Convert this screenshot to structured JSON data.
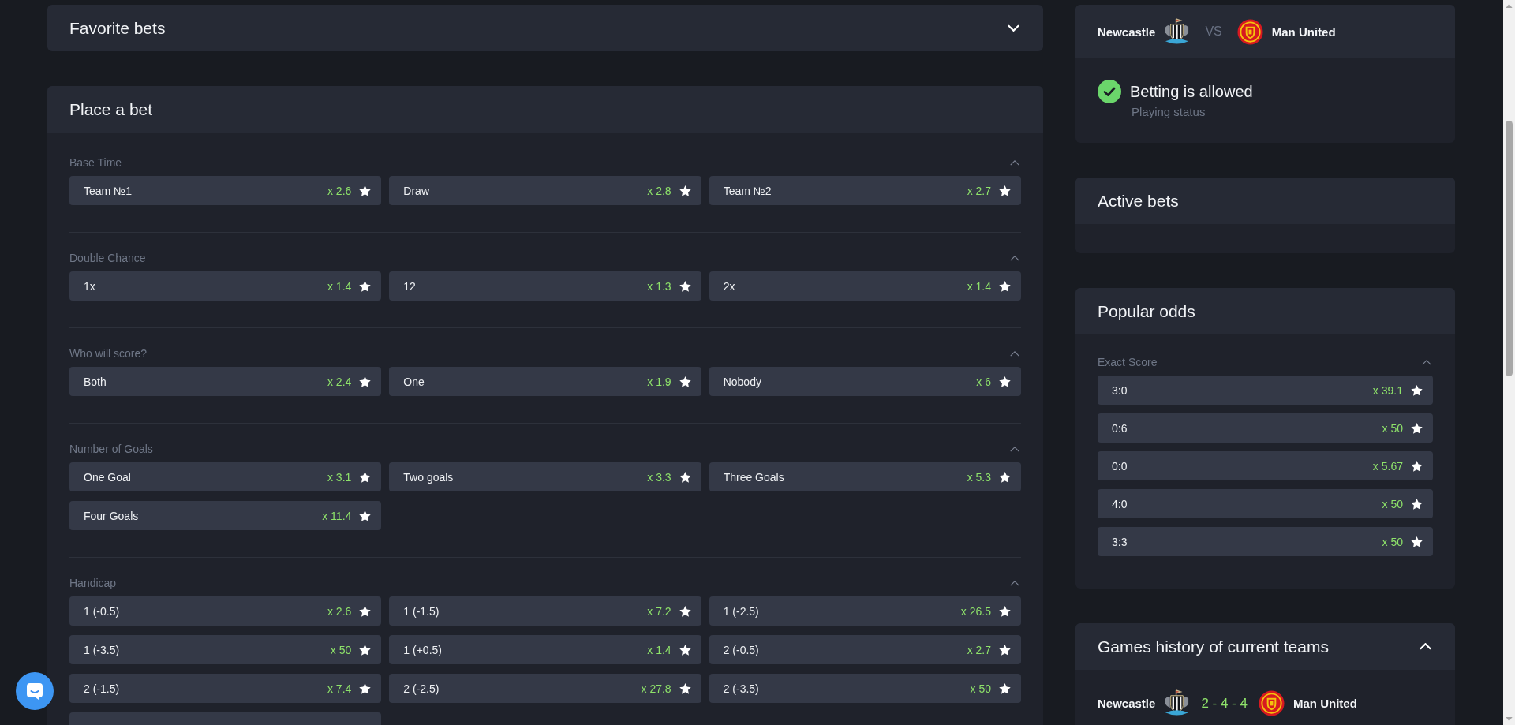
{
  "favorite_bets": {
    "title": "Favorite bets",
    "expanded": false
  },
  "place_a_bet": {
    "title": "Place a bet",
    "sections": [
      {
        "title": "Base Time",
        "expanded": true,
        "options": [
          {
            "label": "Team №1",
            "odds": "x 2.6"
          },
          {
            "label": "Draw",
            "odds": "x 2.8"
          },
          {
            "label": "Team №2",
            "odds": "x 2.7"
          }
        ]
      },
      {
        "title": "Double Chance",
        "expanded": true,
        "options": [
          {
            "label": "1x",
            "odds": "x 1.4"
          },
          {
            "label": "12",
            "odds": "x 1.3"
          },
          {
            "label": "2x",
            "odds": "x 1.4"
          }
        ]
      },
      {
        "title": "Who will score?",
        "expanded": true,
        "options": [
          {
            "label": "Both",
            "odds": "x 2.4"
          },
          {
            "label": "One",
            "odds": "x 1.9"
          },
          {
            "label": "Nobody",
            "odds": "x 6"
          }
        ]
      },
      {
        "title": "Number of Goals",
        "expanded": true,
        "options": [
          {
            "label": "One Goal",
            "odds": "x 3.1"
          },
          {
            "label": "Two goals",
            "odds": "x 3.3"
          },
          {
            "label": "Three Goals",
            "odds": "x 5.3"
          },
          {
            "label": "Four Goals",
            "odds": "x 11.4"
          }
        ]
      },
      {
        "title": "Handicap",
        "expanded": true,
        "continues_below": true,
        "options": [
          {
            "label": "1 (-0.5)",
            "odds": "x 2.6"
          },
          {
            "label": "1 (-1.5)",
            "odds": "x 7.2"
          },
          {
            "label": "1 (-2.5)",
            "odds": "x 26.5"
          },
          {
            "label": "1 (-3.5)",
            "odds": "x 50"
          },
          {
            "label": "1 (+0.5)",
            "odds": "x 1.4"
          },
          {
            "label": "2 (-0.5)",
            "odds": "x 2.7"
          },
          {
            "label": "2 (-1.5)",
            "odds": "x 7.4"
          },
          {
            "label": "2 (-2.5)",
            "odds": "x 27.8"
          },
          {
            "label": "2 (-3.5)",
            "odds": "x 50"
          }
        ]
      }
    ]
  },
  "match": {
    "home_team": "Newcastle",
    "vs": "VS",
    "away_team": "Man United",
    "status": {
      "allowed": true,
      "title": "Betting is allowed",
      "subtitle": "Playing status"
    }
  },
  "active_bets": {
    "title": "Active bets"
  },
  "popular_odds": {
    "title": "Popular odds",
    "sections": [
      {
        "title": "Exact Score",
        "expanded": true,
        "options": [
          {
            "label": "3:0",
            "odds": "x 39.1"
          },
          {
            "label": "0:6",
            "odds": "x 50"
          },
          {
            "label": "0:0",
            "odds": "x 5.67"
          },
          {
            "label": "4:0",
            "odds": "x 50"
          },
          {
            "label": "3:3",
            "odds": "x 50"
          }
        ]
      }
    ]
  },
  "games_history": {
    "title": "Games history of current teams",
    "expanded": true,
    "matches": [
      {
        "home_team": "Newcastle",
        "score": "2 - 4 - 4",
        "away_team": "Man United"
      }
    ]
  }
}
